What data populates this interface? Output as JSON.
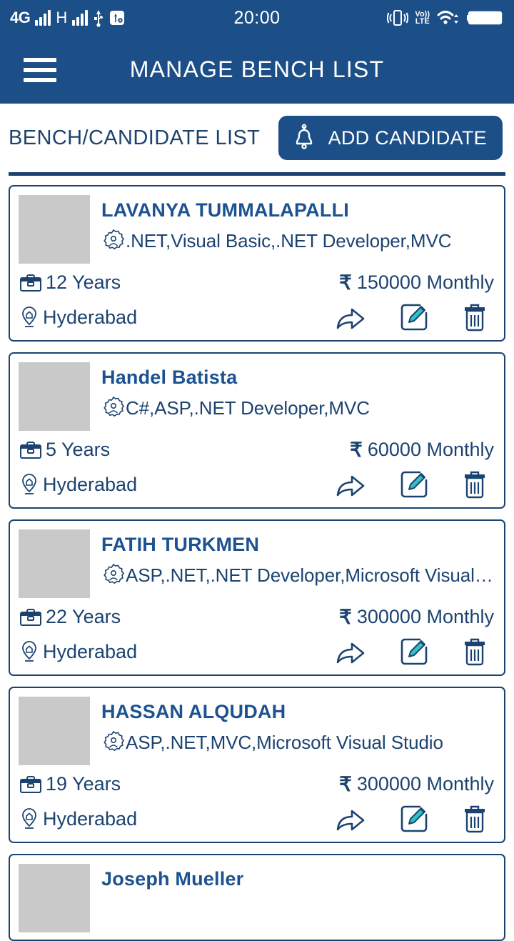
{
  "status_bar": {
    "network_type": "4G",
    "secondary_network": "H",
    "clock": "20:00",
    "volte_label_top": "Vo))",
    "volte_label_bottom": "LTE",
    "icons": [
      "signal-bars-icon",
      "signal-bars-icon",
      "usb-icon",
      "usb-debug-icon",
      "vibrate-icon",
      "volte-icon",
      "wifi-icon",
      "battery-icon"
    ]
  },
  "app_bar": {
    "title": "MANAGE BENCH LIST",
    "menu_icon": "hamburger-menu-icon",
    "background": "#1c4e87"
  },
  "section": {
    "title": "BENCH/CANDIDATE LIST",
    "add_button_label": "ADD CANDIDATE",
    "add_button_icon": "bell-icon"
  },
  "colors": {
    "brand_blue": "#1c4e87",
    "text_blue": "#1c4370",
    "name_blue": "#1c5291",
    "accent_teal": "#2fc4c4",
    "avatar_placeholder": "#c9c9c9"
  },
  "card_actions": {
    "share_label": "share-icon",
    "edit_label": "edit-icon",
    "delete_label": "delete-icon"
  },
  "candidates": [
    {
      "name": "LAVANYA TUMMALAPALLI",
      "skills": ".NET,Visual Basic,.NET Developer,MVC",
      "experience": "12 Years",
      "salary": "150000 Monthly",
      "currency": "₹",
      "location": "Hyderabad"
    },
    {
      "name": "Handel  Batista",
      "skills": "C#,ASP,.NET Developer,MVC",
      "experience": "5 Years",
      "salary": "60000 Monthly",
      "currency": "₹",
      "location": "Hyderabad"
    },
    {
      "name": "FATIH  TURKMEN",
      "skills": "ASP,.NET,.NET Developer,Microsoft Visual Studio",
      "experience": "22 Years",
      "salary": "300000 Monthly",
      "currency": "₹",
      "location": "Hyderabad"
    },
    {
      "name": "HASSAN ALQUDAH",
      "skills": "ASP,.NET,MVC,Microsoft Visual Studio",
      "experience": "19 Years",
      "salary": "300000 Monthly",
      "currency": "₹",
      "location": "Hyderabad"
    },
    {
      "name": "Joseph  Mueller",
      "skills": "",
      "experience": "",
      "salary": "",
      "currency": "₹",
      "location": ""
    }
  ]
}
